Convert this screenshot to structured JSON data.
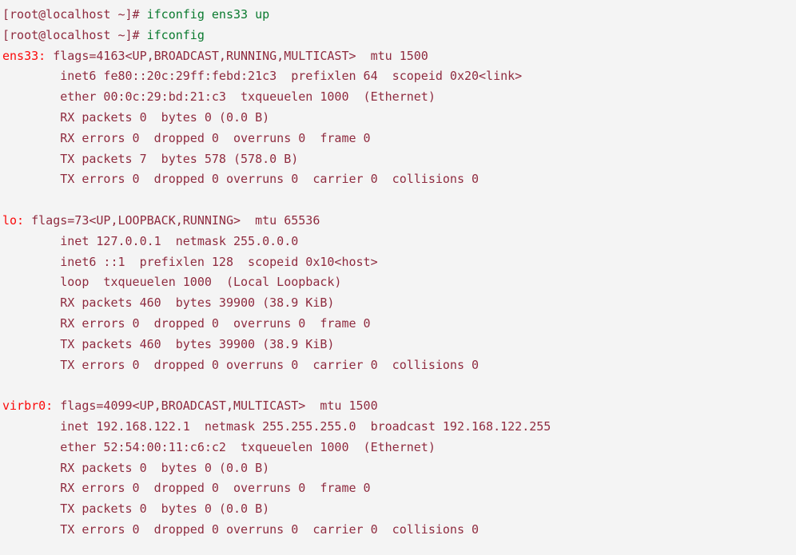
{
  "terminal": {
    "background_color": "#f4f4f4",
    "colors": {
      "prompt": "#8f2b3f",
      "command": "#0a7a2f",
      "interface_name": "#fa0a0a",
      "body_text": "#8f2b3f"
    },
    "prompt_string": "[root@localhost ~]# ",
    "lines": [
      {
        "type": "command",
        "prompt": "[root@localhost ~]# ",
        "command": "ifconfig ens33 up"
      },
      {
        "type": "command",
        "prompt": "[root@localhost ~]# ",
        "command": "ifconfig"
      },
      {
        "type": "iface_header",
        "iface": "ens33: ",
        "rest": "flags=4163<UP,BROADCAST,RUNNING,MULTICAST>  mtu 1500"
      },
      {
        "type": "body",
        "text": "        inet6 fe80::20c:29ff:febd:21c3  prefixlen 64  scopeid 0x20<link>"
      },
      {
        "type": "body",
        "text": "        ether 00:0c:29:bd:21:c3  txqueuelen 1000  (Ethernet)"
      },
      {
        "type": "body",
        "text": "        RX packets 0  bytes 0 (0.0 B)"
      },
      {
        "type": "body",
        "text": "        RX errors 0  dropped 0  overruns 0  frame 0"
      },
      {
        "type": "body",
        "text": "        TX packets 7  bytes 578 (578.0 B)"
      },
      {
        "type": "body",
        "text": "        TX errors 0  dropped 0 overruns 0  carrier 0  collisions 0"
      },
      {
        "type": "blank",
        "text": ""
      },
      {
        "type": "iface_header",
        "iface": "lo: ",
        "rest": "flags=73<UP,LOOPBACK,RUNNING>  mtu 65536"
      },
      {
        "type": "body",
        "text": "        inet 127.0.0.1  netmask 255.0.0.0"
      },
      {
        "type": "body",
        "text": "        inet6 ::1  prefixlen 128  scopeid 0x10<host>"
      },
      {
        "type": "body",
        "text": "        loop  txqueuelen 1000  (Local Loopback)"
      },
      {
        "type": "body",
        "text": "        RX packets 460  bytes 39900 (38.9 KiB)"
      },
      {
        "type": "body",
        "text": "        RX errors 0  dropped 0  overruns 0  frame 0"
      },
      {
        "type": "body",
        "text": "        TX packets 460  bytes 39900 (38.9 KiB)"
      },
      {
        "type": "body",
        "text": "        TX errors 0  dropped 0 overruns 0  carrier 0  collisions 0"
      },
      {
        "type": "blank",
        "text": ""
      },
      {
        "type": "iface_header",
        "iface": "virbr0: ",
        "rest": "flags=4099<UP,BROADCAST,MULTICAST>  mtu 1500"
      },
      {
        "type": "body",
        "text": "        inet 192.168.122.1  netmask 255.255.255.0  broadcast 192.168.122.255"
      },
      {
        "type": "body",
        "text": "        ether 52:54:00:11:c6:c2  txqueuelen 1000  (Ethernet)"
      },
      {
        "type": "body",
        "text": "        RX packets 0  bytes 0 (0.0 B)"
      },
      {
        "type": "body",
        "text": "        RX errors 0  dropped 0  overruns 0  frame 0"
      },
      {
        "type": "body",
        "text": "        TX packets 0  bytes 0 (0.0 B)"
      },
      {
        "type": "body",
        "text": "        TX errors 0  dropped 0 overruns 0  carrier 0  collisions 0"
      }
    ]
  }
}
